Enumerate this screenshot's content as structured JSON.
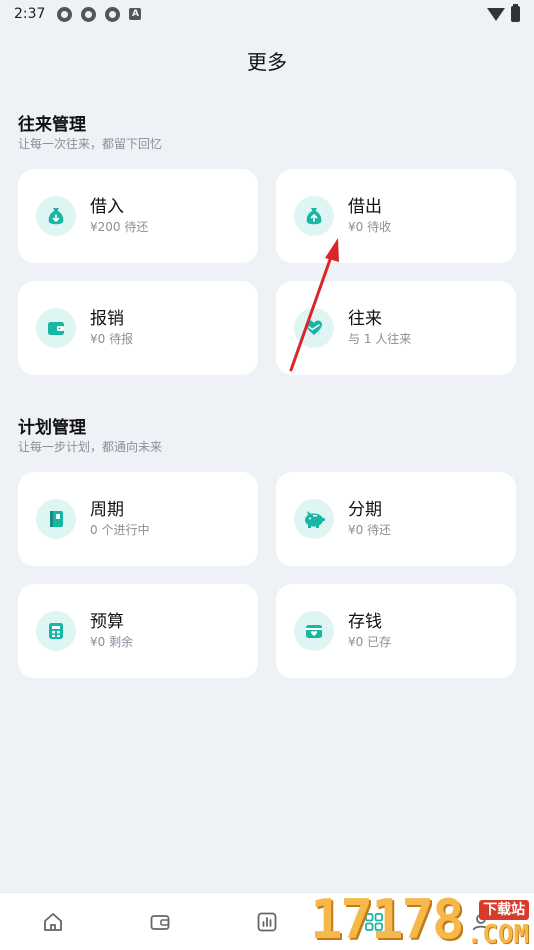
{
  "status_bar": {
    "time": "2:37",
    "badge": "A"
  },
  "page": {
    "title": "更多"
  },
  "sections": [
    {
      "title": "往来管理",
      "subtitle": "让每一次往来，都留下回忆",
      "items": [
        {
          "label": "借入",
          "sub": "¥200 待还",
          "icon": "money-bag-down-icon"
        },
        {
          "label": "借出",
          "sub": "¥0 待收",
          "icon": "money-bag-up-icon"
        },
        {
          "label": "报销",
          "sub": "¥0 待报",
          "icon": "wallet-icon"
        },
        {
          "label": "往来",
          "sub": "与 1 人往来",
          "icon": "heart-hands-icon"
        }
      ]
    },
    {
      "title": "计划管理",
      "subtitle": "让每一步计划，都通向未来",
      "items": [
        {
          "label": "周期",
          "sub": "0 个进行中",
          "icon": "book-icon"
        },
        {
          "label": "分期",
          "sub": "¥0 待还",
          "icon": "piggy-bank-icon"
        },
        {
          "label": "预算",
          "sub": "¥0 剩余",
          "icon": "calculator-icon"
        },
        {
          "label": "存钱",
          "sub": "¥0 已存",
          "icon": "card-heart-icon"
        }
      ]
    }
  ],
  "tab_bar": [
    "home-icon",
    "wallet-icon",
    "chart-icon",
    "grid-icon",
    "profile-icon"
  ],
  "watermark": {
    "digits": "17178",
    "badge": "下载站",
    "suffix": ".COM"
  },
  "colors": {
    "accent": "#19b5a5",
    "icon_bg": "#dff5f3",
    "background": "#eef1f6",
    "arrow": "#d9262a"
  }
}
